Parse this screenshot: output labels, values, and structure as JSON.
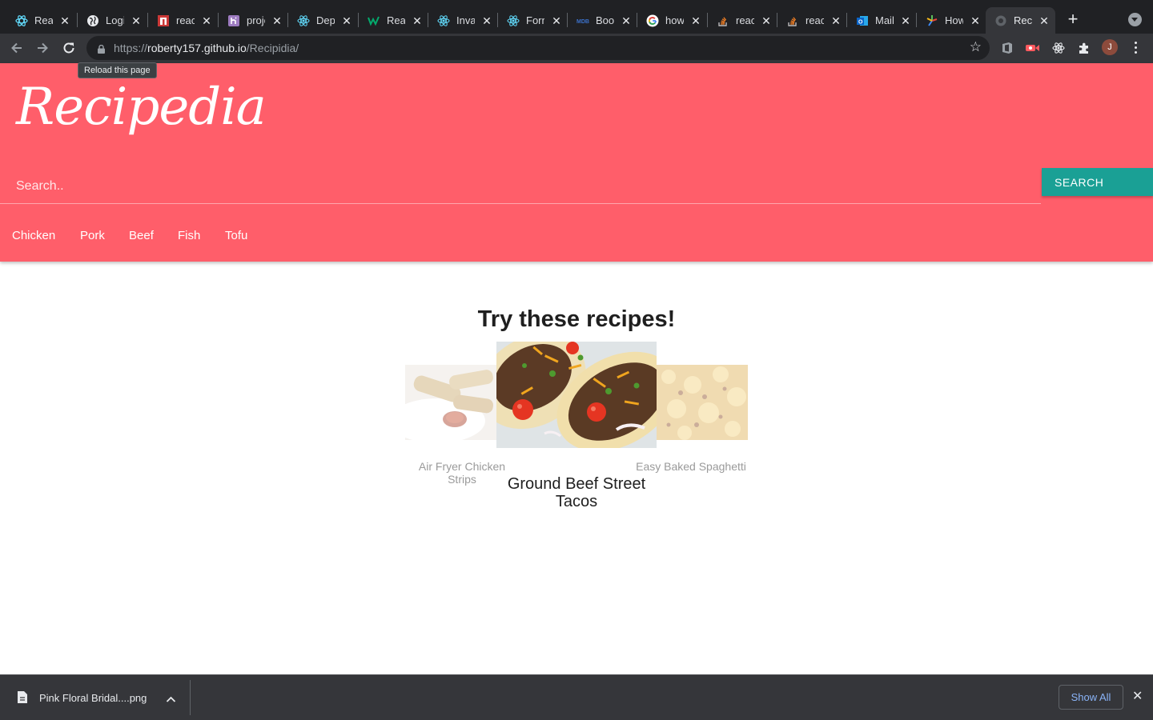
{
  "browser": {
    "tabs": [
      {
        "title": "React",
        "icon": "react-bootstrap-icon",
        "color": "#61dafb"
      },
      {
        "title": "Login",
        "icon": "globe-icon",
        "color": "#e8eaed"
      },
      {
        "title": "react",
        "icon": "npm-icon",
        "color": "#cb3837"
      },
      {
        "title": "project",
        "icon": "heroku-icon",
        "color": "#9e7cc1"
      },
      {
        "title": "Deploy",
        "icon": "react-icon",
        "color": "#61dafb"
      },
      {
        "title": "React",
        "icon": "w3schools-icon",
        "color": "#04aa6d"
      },
      {
        "title": "Invalid",
        "icon": "react-icon",
        "color": "#61dafb"
      },
      {
        "title": "Forms",
        "icon": "react-icon",
        "color": "#61dafb"
      },
      {
        "title": "Bootstrap",
        "icon": "mdb-icon",
        "color": "#3b71ca"
      },
      {
        "title": "how",
        "icon": "google-icon",
        "color": "#4285f4"
      },
      {
        "title": "react",
        "icon": "stackoverflow-icon",
        "color": "#f48024"
      },
      {
        "title": "react",
        "icon": "stackoverflow-icon",
        "color": "#f48024"
      },
      {
        "title": "Mail",
        "icon": "outlook-icon",
        "color": "#0a64c8"
      },
      {
        "title": "How",
        "icon": "pinwheel-icon",
        "color": "#5bbf5b"
      },
      {
        "title": "Recipedia",
        "icon": "loading-globe-icon",
        "color": "#5f6368",
        "active": true
      }
    ],
    "url_scheme": "https://",
    "url_host": "roberty157.github.io",
    "url_path": "/Recipidia/",
    "tooltip": "Reload this page",
    "profile_initial": "J"
  },
  "header": {
    "logo": "Recipedia",
    "search_placeholder": "Search..",
    "search_button": "SEARCH",
    "categories": [
      "Chicken",
      "Pork",
      "Beef",
      "Fish",
      "Tofu"
    ]
  },
  "featured": {
    "title": "Try these recipes!",
    "recipes": [
      {
        "name": "Air Fryer Chicken Strips"
      },
      {
        "name": "Ground Beef Street Tacos"
      },
      {
        "name": "Easy Baked Spaghetti"
      }
    ]
  },
  "downloads": {
    "file_name": "Pink Floral Bridal....png",
    "show_all": "Show All"
  },
  "colors": {
    "header_bg": "#ff5e6a",
    "search_button_bg": "#1aa095",
    "chrome_dark": "#202124",
    "chrome_toolbar": "#35363a"
  }
}
